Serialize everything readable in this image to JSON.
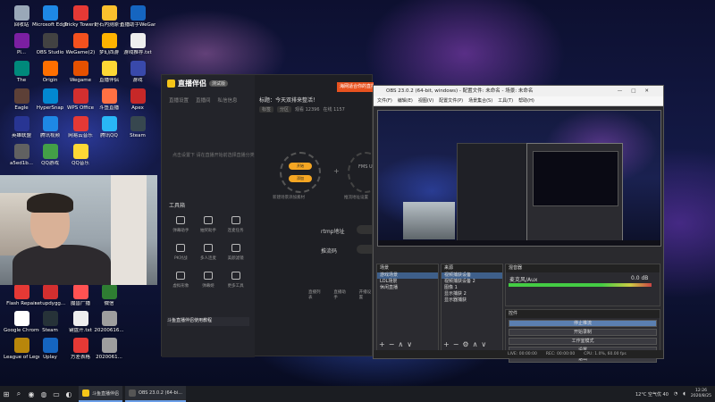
{
  "desktop_icons": [
    {
      "label": "回收站",
      "color": "#9aa8b8"
    },
    {
      "label": "Microsoft Edge",
      "color": "#1e88e5"
    },
    {
      "label": "Tricky Towers",
      "color": "#e53935"
    },
    {
      "label": "好石内测原子",
      "color": "#fbc02d"
    },
    {
      "label": "直播助手WeGame版",
      "color": "#1565c0"
    },
    {
      "label": "Pl...",
      "color": "#7b1fa2"
    },
    {
      "label": "OBS Studio",
      "color": "#424242"
    },
    {
      "label": "WeGame(2)",
      "color": "#f4511e"
    },
    {
      "label": "梦幻西游",
      "color": "#ffb300"
    },
    {
      "label": "游戏推荐.txt",
      "color": "#eeeeee"
    },
    {
      "label": "The",
      "color": "#00897b"
    },
    {
      "label": "Origin",
      "color": "#ff6f00"
    },
    {
      "label": "Wegame",
      "color": "#e65100"
    },
    {
      "label": "直播伴侣",
      "color": "#fdd835"
    },
    {
      "label": "游戏",
      "color": "#3949ab"
    },
    {
      "label": "Eagle",
      "color": "#5d4037"
    },
    {
      "label": "HyperSnap",
      "color": "#0288d1"
    },
    {
      "label": "WPS Office",
      "color": "#d32f2f"
    },
    {
      "label": "斗鱼直播",
      "color": "#ff7043"
    },
    {
      "label": "Apex",
      "color": "#c62828"
    },
    {
      "label": "英雄联盟",
      "color": "#283593"
    },
    {
      "label": "腾讯视频",
      "color": "#1e88e5"
    },
    {
      "label": "网易云音乐",
      "color": "#e53935"
    },
    {
      "label": "腾讯QQ",
      "color": "#29b6f6"
    },
    {
      "label": "Steam",
      "color": "#37474f"
    },
    {
      "label": "a5ed1b...",
      "color": "#616161"
    },
    {
      "label": "QQ游戏",
      "color": "#43a047"
    },
    {
      "label": "QQ音乐",
      "color": "#fdd835"
    },
    {
      "label": "Flash Repair",
      "color": "#e53935"
    },
    {
      "label": "setupdygg...",
      "color": "#d32f2f"
    },
    {
      "label": "魔兽广播",
      "color": "#ff5252"
    },
    {
      "label": "微信",
      "color": "#2e7d32"
    },
    {
      "label": "Google Chrome",
      "color": "#ffffff"
    },
    {
      "label": "Steam",
      "color": "#263238"
    },
    {
      "label": "键盘开.txt",
      "color": "#eeeeee"
    },
    {
      "label": "20200616...",
      "color": "#9e9e9e"
    },
    {
      "label": "League of Legends",
      "color": "#b8860b"
    },
    {
      "label": "Uplay",
      "color": "#1565c0"
    },
    {
      "label": "方差表格",
      "color": "#e53935"
    },
    {
      "label": "2020061...",
      "color": "#9e9e9e"
    }
  ],
  "live_companion": {
    "app_name": "直播伴侣",
    "version": "测试版",
    "tabs": [
      "直播设置",
      "直播间",
      "私信信息"
    ],
    "left_hint": "点击设置下 请在直播开始前选择直播分类",
    "tools_header": "工具箱",
    "tools": [
      {
        "label": "弹幕助手"
      },
      {
        "label": "抽奖助手"
      },
      {
        "label": "连麦任务"
      },
      {
        "label": "PK对战"
      },
      {
        "label": "多人连麦"
      },
      {
        "label": "美颜滤镜"
      },
      {
        "label": "虚拟形象"
      },
      {
        "label": "弹幕姬"
      },
      {
        "label": "更多工具"
      }
    ],
    "banner": "斗鱼直播伴侣使用教程",
    "promo": "海网适合你的直播玩法",
    "room_title": "标题：今天双排来整活！",
    "meta": [
      "标签",
      "分区",
      "观看 12396",
      "在线 1157"
    ],
    "category": "英雄联盟 · 大神推荐",
    "scene_buttons": [
      "开始",
      "添加"
    ],
    "fms_label": "FMS URL",
    "caption_left": "新建场景添加素材",
    "caption_right": "推流地址设置",
    "rtmp_label": "rtmp地址",
    "key_label": "推流码",
    "bottom_actions": [
      "直播列表",
      "直播助手",
      "开播设置"
    ]
  },
  "obs": {
    "title": "OBS 23.0.2 (64-bit, windows) - 配置文件: 未命名 - 场景: 未命名",
    "menu": [
      "文件(F)",
      "编辑(E)",
      "视图(V)",
      "配置文件(P)",
      "场景集合(S)",
      "工具(T)",
      "帮助(H)"
    ],
    "docks": {
      "scenes": {
        "header": "场景",
        "items": [
          "游戏场景",
          "LOL场景",
          "休闲直播"
        ]
      },
      "sources": {
        "header": "来源",
        "items": [
          "视频捕获设备",
          "视频捕获设备 2",
          "图像 1",
          "显示捕获 2",
          "显示器捕获"
        ]
      },
      "mixer": {
        "header": "混音器",
        "track": "麦克风/Aux",
        "level": "0.0 dB",
        "fill_percent": 65
      },
      "controls": {
        "header": "控件",
        "buttons": [
          "停止推流",
          "开始录制",
          "工作室模式",
          "设置",
          "退出"
        ]
      }
    },
    "status": [
      "LIVE: 00:00:00",
      "REC: 00:00:00",
      "CPU: 1.0%, 60.00 fps"
    ]
  },
  "taskbar": {
    "apps": [
      {
        "label": "斗鱼直播伴侣",
        "color": "#f5c518"
      },
      {
        "label": "OBS 23.0.2 (64-bi...",
        "color": "#555555"
      }
    ],
    "weather": "12°C 空气优 40",
    "time": "12:26",
    "date": "2020/8/25"
  }
}
